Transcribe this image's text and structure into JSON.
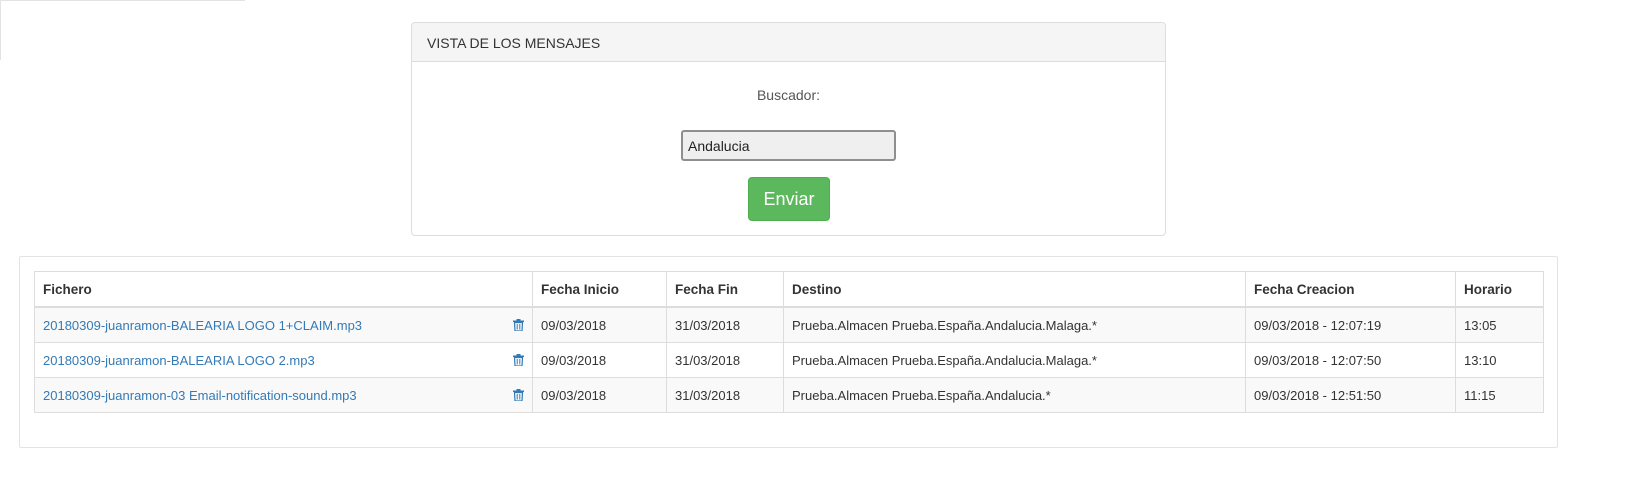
{
  "panel": {
    "heading": "VISTA DE LOS MENSAJES",
    "search_label": "Buscador:",
    "search_value": "Andalucia",
    "submit_label": "Enviar"
  },
  "colors": {
    "accent_button": "#5cb85c",
    "link": "#337ab7"
  },
  "table": {
    "headers": {
      "file": "Fichero",
      "start_date": "Fecha Inicio",
      "end_date": "Fecha Fin",
      "destination": "Destino",
      "created": "Fecha Creacion",
      "schedule": "Horario"
    },
    "rows": [
      {
        "file": "20180309-juanramon-BALEARIA LOGO 1+CLAIM.mp3",
        "start_date": "09/03/2018",
        "end_date": "31/03/2018",
        "destination": "Prueba.Almacen Prueba.España.Andalucia.Malaga.*",
        "created": "09/03/2018 - 12:07:19",
        "schedule": "13:05",
        "action_icon": "trash-icon"
      },
      {
        "file": "20180309-juanramon-BALEARIA LOGO 2.mp3",
        "start_date": "09/03/2018",
        "end_date": "31/03/2018",
        "destination": "Prueba.Almacen Prueba.España.Andalucia.Malaga.*",
        "created": "09/03/2018 - 12:07:50",
        "schedule": "13:10",
        "action_icon": "trash-icon"
      },
      {
        "file": "20180309-juanramon-03 Email-notification-sound.mp3",
        "start_date": "09/03/2018",
        "end_date": "31/03/2018",
        "destination": "Prueba.Almacen Prueba.España.Andalucia.*",
        "created": "09/03/2018 - 12:51:50",
        "schedule": "11:15",
        "action_icon": "trash-icon"
      }
    ]
  }
}
